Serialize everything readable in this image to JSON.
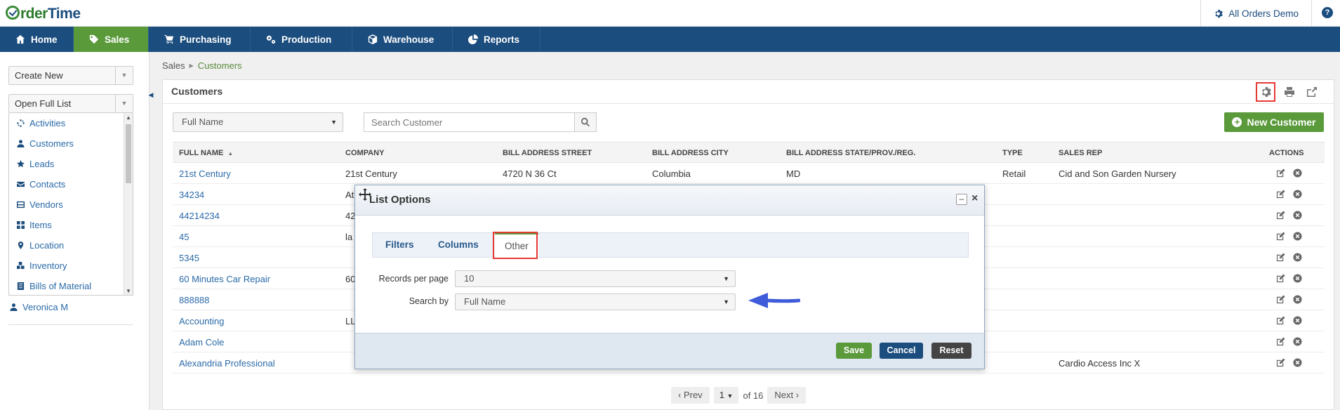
{
  "app": {
    "logo_part1": "rder",
    "logo_part2": "Time",
    "account": "All Orders Demo",
    "help": "?"
  },
  "nav": [
    {
      "label": "Home",
      "icon": "home-icon"
    },
    {
      "label": "Sales",
      "icon": "tag-icon",
      "active": true
    },
    {
      "label": "Purchasing",
      "icon": "cart-icon"
    },
    {
      "label": "Production",
      "icon": "cogs-icon"
    },
    {
      "label": "Warehouse",
      "icon": "cube-icon"
    },
    {
      "label": "Reports",
      "icon": "pie-chart-icon"
    }
  ],
  "sidebar": {
    "create_new": "Create New",
    "open_full_list": "Open Full List",
    "items": [
      {
        "label": "Activities",
        "icon": "spinner-icon"
      },
      {
        "label": "Customers",
        "icon": "user-icon"
      },
      {
        "label": "Leads",
        "icon": "star-icon"
      },
      {
        "label": "Contacts",
        "icon": "envelope-icon"
      },
      {
        "label": "Vendors",
        "icon": "inbox-icon"
      },
      {
        "label": "Items",
        "icon": "grid-icon"
      },
      {
        "label": "Location",
        "icon": "map-marker-icon"
      },
      {
        "label": "Inventory",
        "icon": "cubes-icon"
      },
      {
        "label": "Bills of Material",
        "icon": "list-icon"
      }
    ],
    "user": "Veronica M"
  },
  "breadcrumb": {
    "parent": "Sales",
    "current": "Customers"
  },
  "panel": {
    "title": "Customers",
    "search_by": "Full Name",
    "search_placeholder": "Search Customer",
    "new_button": "New Customer"
  },
  "table": {
    "columns": [
      "Full Name",
      "Company",
      "Bill Address Street",
      "Bill Address City",
      "Bill Address State/Prov./Reg.",
      "Type",
      "Sales Rep",
      "Actions"
    ],
    "rows": [
      {
        "name": "21st Century",
        "company": "21st Century",
        "street": "4720 N 36 Ct",
        "city": "Columbia",
        "state": "MD",
        "type": "Retail",
        "rep": "Cid and Son Garden Nursery"
      },
      {
        "name": "34234",
        "company": "At",
        "street": "",
        "city": "",
        "state": "",
        "type": "",
        "rep": ""
      },
      {
        "name": "44214234",
        "company": "42",
        "street": "",
        "city": "",
        "state": "",
        "type": "",
        "rep": ""
      },
      {
        "name": "45",
        "company": "la",
        "street": "",
        "city": "",
        "state": "",
        "type": "",
        "rep": ""
      },
      {
        "name": "5345",
        "company": "",
        "street": "",
        "city": "",
        "state": "",
        "type": "",
        "rep": ""
      },
      {
        "name": "60 Minutes Car Repair",
        "company": "60",
        "street": "",
        "city": "",
        "state": "",
        "type": "",
        "rep": ""
      },
      {
        "name": "888888",
        "company": "",
        "street": "",
        "city": "",
        "state": "",
        "type": "",
        "rep": ""
      },
      {
        "name": "Accounting",
        "company": "LL",
        "street": "",
        "city": "",
        "state": "",
        "type": "",
        "rep": ""
      },
      {
        "name": "Adam Cole",
        "company": "",
        "street": "",
        "city": "",
        "state": "",
        "type": "",
        "rep": ""
      },
      {
        "name": "Alexandria Professional",
        "company": "",
        "street": "",
        "city": "",
        "state": "",
        "type": "",
        "rep": "Cardio Access Inc X"
      }
    ]
  },
  "pager": {
    "prev": "Prev",
    "page": "1",
    "of": "of 16",
    "next": "Next"
  },
  "modal": {
    "title": "List Options",
    "tabs": [
      "Filters",
      "Columns",
      "Other"
    ],
    "records_label": "Records per page",
    "records_value": "10",
    "search_label": "Search by",
    "search_value": "Full Name",
    "save": "Save",
    "cancel": "Cancel",
    "reset": "Reset"
  },
  "colors": {
    "nav": "#1b4d7e",
    "active": "#5a9a3b",
    "highlight": "#e53935",
    "arrow": "#3f5bd9"
  }
}
